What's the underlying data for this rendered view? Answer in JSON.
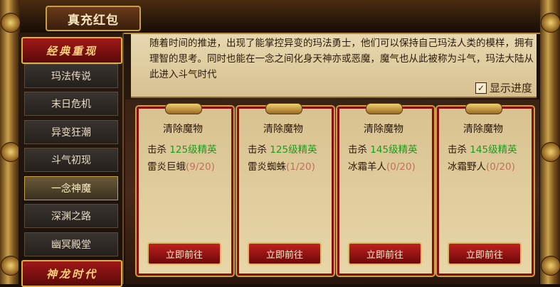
{
  "window": {
    "title": "真充红包"
  },
  "sidebar": {
    "header_top": "经典重现",
    "items": [
      {
        "label": "玛法传说"
      },
      {
        "label": "末日危机"
      },
      {
        "label": "异变狂潮"
      },
      {
        "label": "斗气初现"
      },
      {
        "label": "一念神魔",
        "active": true
      },
      {
        "label": "深渊之路"
      },
      {
        "label": "幽冥殿堂"
      }
    ],
    "header_bottom": "神龙时代"
  },
  "description": {
    "text": "随着时间的推进，出现了能掌控异变的玛法勇士，他们可以保持自己玛法人类的模样，拥有理智的思考。同时也能在一念之间化身天神亦或恶魔，魔气也从此被称为斗气，玛法大陆从此进入斗气时代",
    "show_progress_label": "显示进度",
    "show_progress_checked": true
  },
  "cards": [
    {
      "title": "清除魔物",
      "kill_label": "击杀",
      "level": "125级精",
      "elite_prefix": "英",
      "monster": "雷炎巨蛾",
      "progress": "(9/20)",
      "button": "立即前往"
    },
    {
      "title": "清除魔物",
      "kill_label": "击杀",
      "level": "125级精",
      "elite_prefix": "英",
      "monster": "雷炎蜘蛛",
      "progress": "(1/20)",
      "button": "立即前往"
    },
    {
      "title": "清除魔物",
      "kill_label": "击杀",
      "level": "145级精",
      "elite_prefix": "英",
      "monster": "冰霜羊人",
      "progress": "(0/20)",
      "button": "立即前往"
    },
    {
      "title": "清除魔物",
      "kill_label": "击杀",
      "level": "145级精",
      "elite_prefix": "英",
      "monster": "冰霜野人",
      "progress": "(0/20)",
      "button": "立即前往"
    }
  ],
  "colors": {
    "accent_gold": "#c9a04a",
    "card_border_red": "#8a1010",
    "level_green": "#1e9a1e",
    "progress_red": "#c07060"
  }
}
